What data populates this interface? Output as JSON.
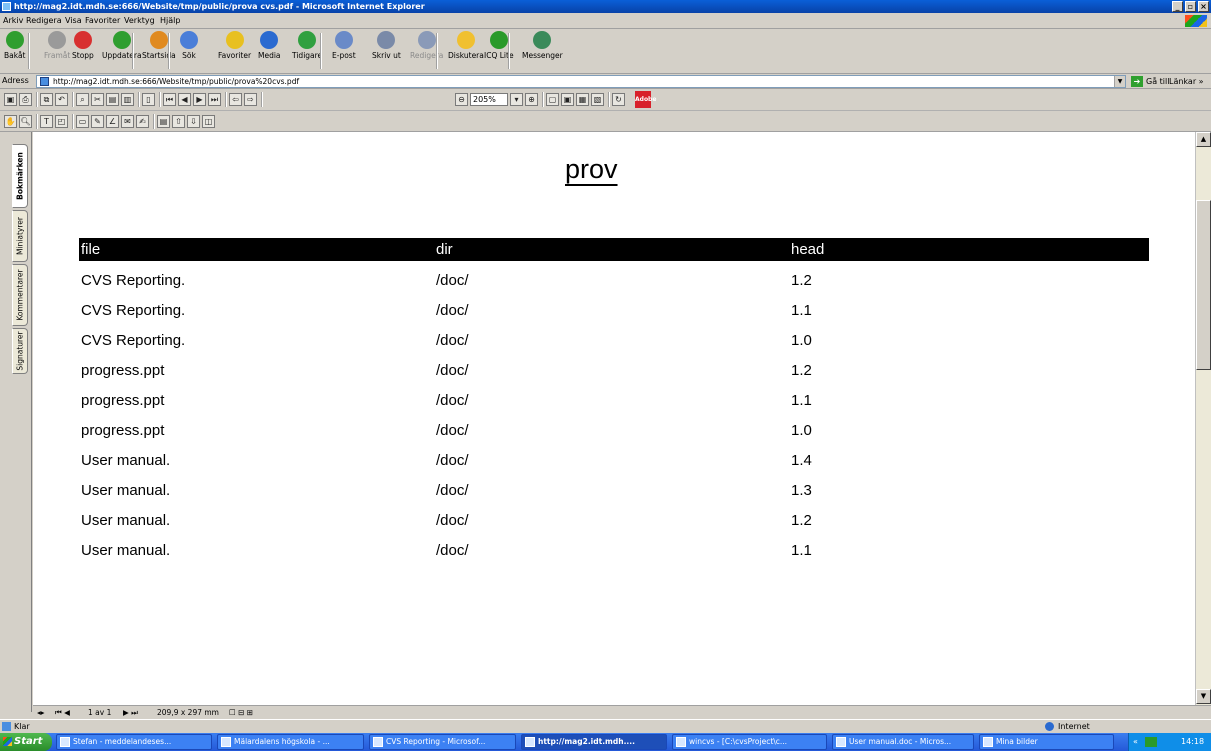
{
  "window": {
    "title": "http://mag2.idt.mdh.se:666/Website/tmp/public/prova cvs.pdf - Microsoft Internet Explorer"
  },
  "menu": [
    "Arkiv",
    "Redigera",
    "Visa",
    "Favoriter",
    "Verktyg",
    "Hjälp"
  ],
  "toolbar": [
    {
      "label": "Bakåt",
      "icon": "back-arrow-icon",
      "color": "#2f9e2f",
      "disabled": false
    },
    {
      "label": "Framåt",
      "icon": "forward-arrow-icon",
      "color": "#9a9a9a",
      "disabled": true
    },
    {
      "label": "Stopp",
      "icon": "stop-icon",
      "color": "#d83030",
      "disabled": false
    },
    {
      "label": "Uppdatera",
      "icon": "refresh-icon",
      "color": "#2f9e2f",
      "disabled": false
    },
    {
      "label": "Startsida",
      "icon": "home-icon",
      "color": "#e08a20",
      "disabled": false
    },
    {
      "label": "Sök",
      "icon": "search-icon",
      "color": "#4a7ed8",
      "disabled": false
    },
    {
      "label": "Favoriter",
      "icon": "star-icon",
      "color": "#e8c020",
      "disabled": false
    },
    {
      "label": "Media",
      "icon": "media-icon",
      "color": "#2a6ad0",
      "disabled": false
    },
    {
      "label": "Tidigare",
      "icon": "history-icon",
      "color": "#30a040",
      "disabled": false
    },
    {
      "label": "E-post",
      "icon": "mail-icon",
      "color": "#6a8ac8",
      "disabled": false
    },
    {
      "label": "Skriv ut",
      "icon": "print-icon",
      "color": "#7a8aa8",
      "disabled": false
    },
    {
      "label": "Redigera",
      "icon": "edit-icon",
      "color": "#8a9ab8",
      "disabled": true
    },
    {
      "label": "Diskutera",
      "icon": "discuss-icon",
      "color": "#f0c030",
      "disabled": false
    },
    {
      "label": "ICQ Lite",
      "icon": "icq-flower-icon",
      "color": "#2a9a2a",
      "disabled": false
    },
    {
      "label": "Messenger",
      "icon": "messenger-icon",
      "color": "#3a8a5a",
      "disabled": false
    }
  ],
  "address": {
    "label": "Adress",
    "value": "http://mag2.idt.mdh.se:666/Website/tmp/public/prova%20cvs.pdf",
    "go": "Gå till",
    "links": "Länkar »"
  },
  "pdf": {
    "zoom": "205%"
  },
  "side_tabs": [
    "Bokmärken",
    "Miniatyrer",
    "Kommentarer",
    "Signaturer"
  ],
  "document": {
    "title": "prov",
    "columns": [
      "file",
      "dir",
      "head"
    ],
    "rows": [
      [
        "CVS Reporting.",
        "/doc/",
        "1.2"
      ],
      [
        "CVS Reporting.",
        "/doc/",
        "1.1"
      ],
      [
        "CVS Reporting.",
        "/doc/",
        "1.0"
      ],
      [
        "progress.ppt",
        "/doc/",
        "1.2"
      ],
      [
        "progress.ppt",
        "/doc/",
        "1.1"
      ],
      [
        "progress.ppt",
        "/doc/",
        "1.0"
      ],
      [
        "User manual.",
        "/doc/",
        "1.4"
      ],
      [
        "User manual.",
        "/doc/",
        "1.3"
      ],
      [
        "User manual.",
        "/doc/",
        "1.2"
      ],
      [
        "User manual.",
        "/doc/",
        "1.1"
      ]
    ]
  },
  "doc_status": {
    "page": "1 av 1",
    "size": "209,9 x 297 mm"
  },
  "status": {
    "text": "Klar",
    "zone": "Internet"
  },
  "taskbar": {
    "start": "Start",
    "tasks": [
      {
        "label": "Stefan - meddelandeses...",
        "active": false
      },
      {
        "label": "Mälardalens högskola - ...",
        "active": false
      },
      {
        "label": "CVS Reporting - Microsof...",
        "active": false
      },
      {
        "label": "http://mag2.idt.mdh....",
        "active": true
      },
      {
        "label": "wincvs - [C:\\cvsProject\\c...",
        "active": false
      },
      {
        "label": "User manual.doc - Micros...",
        "active": false
      },
      {
        "label": "Mina bilder",
        "active": false
      }
    ],
    "clock": "14:18"
  }
}
